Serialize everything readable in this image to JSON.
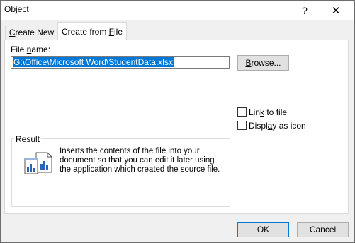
{
  "window": {
    "title": "Object",
    "help_label": "?",
    "close_label": "✕"
  },
  "tabs": [
    {
      "label": "Create New",
      "mnemonic": "C",
      "rest": "reate New"
    },
    {
      "label": "Create from File",
      "pre": "Create from ",
      "mnemonic": "F",
      "rest": "ile"
    }
  ],
  "file_name": {
    "label_pre": "File ",
    "label_mnemonic": "n",
    "label_rest": "ame:",
    "value": "G:\\Office\\Microsoft Word\\StudentData.xlsx"
  },
  "browse_button": {
    "mnemonic": "B",
    "rest": "rowse..."
  },
  "options": {
    "link": {
      "pre": "Lin",
      "mnemonic": "k",
      "rest": " to file",
      "checked": false
    },
    "icon": {
      "pre": "Displ",
      "mnemonic": "a",
      "rest": "y as icon",
      "checked": false
    }
  },
  "result": {
    "title": "Result",
    "text": "Inserts the contents of the file into your document so that you can edit it later using the application which created the source file.",
    "icon": "embed-file-chart-icon"
  },
  "buttons": {
    "ok": "OK",
    "cancel": "Cancel"
  },
  "colors": {
    "selection": "#0078d7",
    "default_border": "#0078d7"
  }
}
